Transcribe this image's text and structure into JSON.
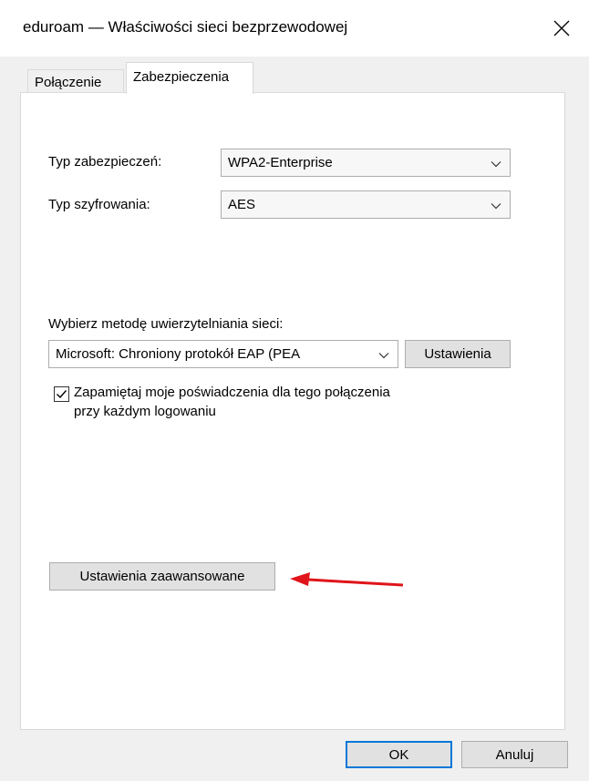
{
  "window": {
    "title": "eduroam — Właściwości sieci bezprzewodowej"
  },
  "tabs": [
    {
      "label": "Połączenie",
      "active": false
    },
    {
      "label": "Zabezpieczenia",
      "active": true
    }
  ],
  "security": {
    "type_label": "Typ zabezpieczeń:",
    "type_value": "WPA2-Enterprise",
    "encryption_label": "Typ szyfrowania:",
    "encryption_value": "AES"
  },
  "auth": {
    "method_label": "Wybierz metodę uwierzytelniania sieci:",
    "method_value": "Microsoft: Chroniony protokół EAP (PEA",
    "settings_button": "Ustawienia"
  },
  "remember": {
    "checked": true,
    "line1": "Zapamiętaj moje poświadczenia dla tego połączenia",
    "line2": "przy każdym logowaniu"
  },
  "advanced_button": "Ustawienia zaawansowane",
  "footer": {
    "ok": "OK",
    "cancel": "Anuluj"
  },
  "colors": {
    "accent": "#0078d7",
    "annotation_arrow": "#e0151b"
  },
  "icons": {
    "close": "close-icon",
    "dropdown": "chevron-down-icon",
    "check": "checkmark-icon",
    "annotation": "red-arrow-icon"
  }
}
